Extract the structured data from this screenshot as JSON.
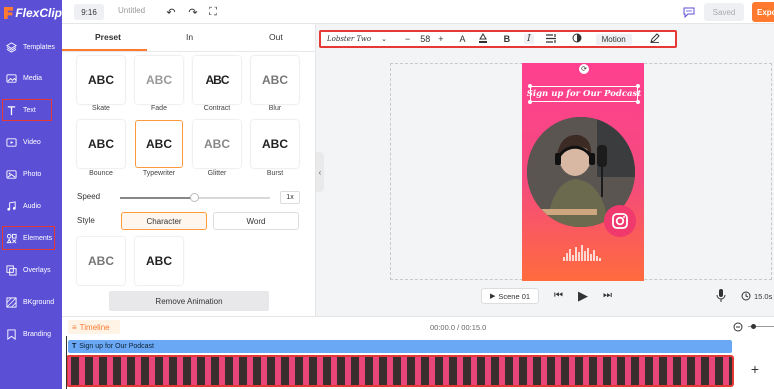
{
  "app": {
    "logo": "FlexClip"
  },
  "sidebar": {
    "items": [
      {
        "label": "Templates",
        "icon": "layers-icon"
      },
      {
        "label": "Media",
        "icon": "media-icon"
      },
      {
        "label": "Text",
        "icon": "text-icon"
      },
      {
        "label": "Video",
        "icon": "video-icon"
      },
      {
        "label": "Photo",
        "icon": "photo-icon"
      },
      {
        "label": "Audio",
        "icon": "audio-icon"
      },
      {
        "label": "Elements",
        "icon": "elements-icon"
      },
      {
        "label": "Overlays",
        "icon": "overlays-icon"
      },
      {
        "label": "BKground",
        "icon": "background-icon"
      },
      {
        "label": "Branding",
        "icon": "branding-icon"
      }
    ]
  },
  "topbar": {
    "ratio": "9:16",
    "title": "Untitled",
    "saved": "Saved",
    "export": "Expo"
  },
  "panel": {
    "tabs": [
      "Preset",
      "In",
      "Out"
    ],
    "effects": [
      {
        "name": "Skate",
        "sample": "ABC"
      },
      {
        "name": "Fade",
        "sample": "ABC"
      },
      {
        "name": "Contract",
        "sample": "ABC"
      },
      {
        "name": "Blur",
        "sample": "ABC"
      },
      {
        "name": "Bounce",
        "sample": "ABC"
      },
      {
        "name": "Typewriter",
        "sample": "ABC"
      },
      {
        "name": "Glitter",
        "sample": "ABC"
      },
      {
        "name": "Burst",
        "sample": "ABC"
      },
      {
        "name": "",
        "sample": "ABC"
      },
      {
        "name": "",
        "sample": "ABC"
      }
    ],
    "speed_label": "Speed",
    "speed_value": "1x",
    "speed_fraction": 0.5,
    "style_label": "Style",
    "style_options": [
      "Character",
      "Word"
    ],
    "style_selected": "Character",
    "remove_button": "Remove Animation"
  },
  "text_toolbar": {
    "font": "Lobster Two",
    "size": "58",
    "minus": "−",
    "plus": "+",
    "motion": "Motion"
  },
  "canvas": {
    "headline": "Sign up for Our Podcast"
  },
  "playback": {
    "scene": "Scene 01",
    "duration": "15.0s"
  },
  "timeline": {
    "label": "Timeline",
    "time": "00:00.0 / 00:15.0",
    "text_track": "Sign up for Our Podcast"
  },
  "colors": {
    "accent": "#ff7a2f",
    "sidebar": "#5b4fd6",
    "highlight": "#e53935"
  }
}
